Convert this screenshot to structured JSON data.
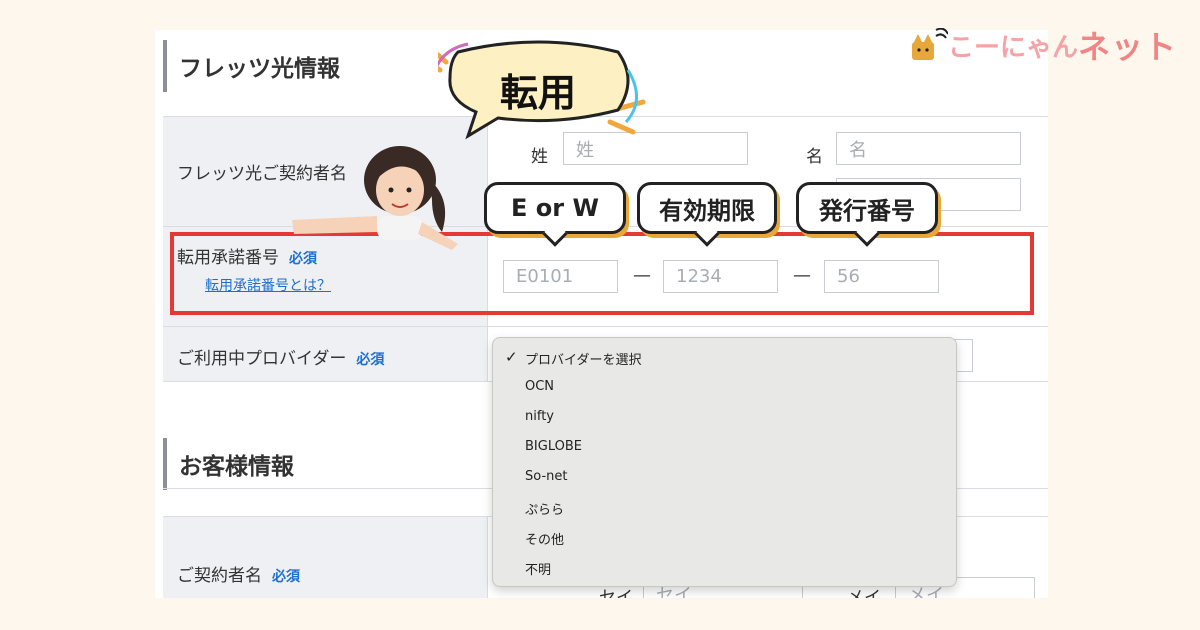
{
  "logo": {
    "soft": "こーにゃん",
    "strong": "ネット"
  },
  "headline_badge": "転用",
  "callouts": {
    "part1": "E or W",
    "part2": "有効期限",
    "part3": "発行番号"
  },
  "sections": {
    "flets": "フレッツ光情報",
    "customer": "お客様情報"
  },
  "contract_name": {
    "label": "フレッツ光ご契約者名",
    "sei_label": "姓",
    "sei_placeholder": "姓",
    "mei_label": "名",
    "mei_placeholder": "名"
  },
  "transfer": {
    "label": "転用承諾番号",
    "required": "必須",
    "help_link": "転用承諾番号とは？",
    "part1_placeholder": "E0101",
    "part2_placeholder": "1234",
    "part3_placeholder": "56",
    "dash": "—"
  },
  "provider": {
    "label": "ご利用中プロバイダー",
    "required": "必須",
    "options": [
      "プロバイダーを選択",
      "OCN",
      "nifty",
      "BIGLOBE",
      "So-net",
      "ぷらら",
      "その他",
      "不明"
    ],
    "selected_index": 0,
    "check": "✓"
  },
  "customer_name": {
    "label": "ご契約者名",
    "required": "必須",
    "sei_label": "セイ",
    "sei_placeholder": "セイ",
    "mei_label": "メイ",
    "mei_placeholder": "メイ"
  },
  "colors": {
    "highlight": "#e53935",
    "link": "#1f6fd1",
    "callout_shadow": "#e8a73a",
    "logo": "#f08585"
  },
  "icons": [
    "cat-mascot-icon",
    "woman-pointing-illustration",
    "speech-bubble-icon",
    "checkmark-icon"
  ]
}
